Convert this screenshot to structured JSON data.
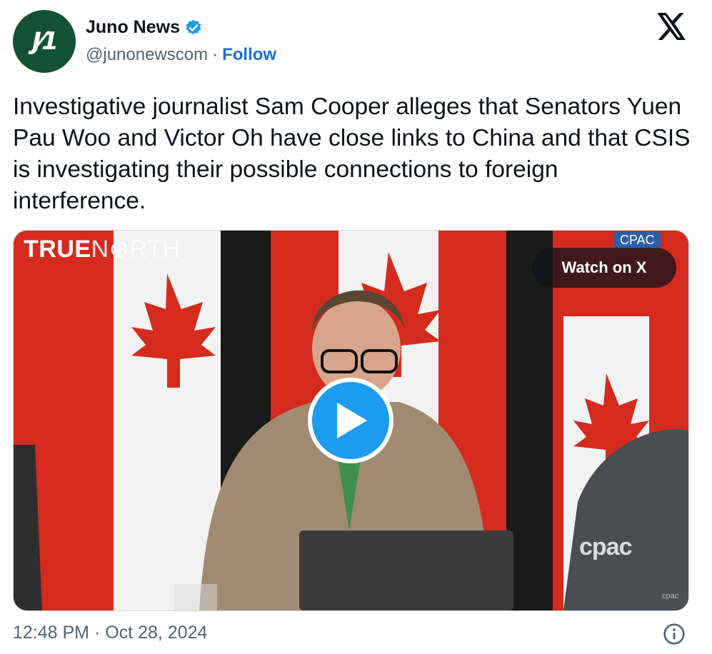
{
  "author": {
    "avatar_text": "J ⁄ 1",
    "name": "Juno News",
    "handle": "@junonewscom",
    "separator": "·",
    "follow_label": "Follow"
  },
  "tweet": {
    "text": "Investigative journalist Sam Cooper alleges that Senators Yuen Pau Woo and Victor Oh have close links to China and that CSIS is investigating their possible connections to foreign interference."
  },
  "media": {
    "watermark_bold": "TRUE",
    "watermark_thin": "N⊕RTH",
    "corner_badge": "CPAC",
    "watch_label": "Watch on X",
    "broadcaster_logo": "cpac",
    "broadcaster_small": "cpac"
  },
  "footer": {
    "timestamp": "12:48 PM · Oct 28, 2024"
  },
  "colors": {
    "brand_green": "#145235",
    "verified_blue": "#1d9bf0",
    "link_blue": "#1d6fd0",
    "flag_red": "#d52b1e"
  },
  "icons": [
    "verified-badge-icon",
    "x-logo-icon",
    "play-icon",
    "info-icon"
  ]
}
